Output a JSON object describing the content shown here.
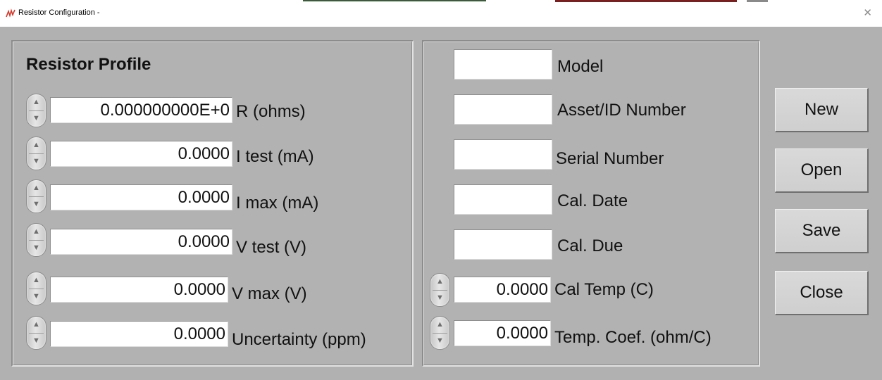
{
  "window": {
    "title": "Resistor Configuration -",
    "close_glyph": "✕",
    "app_icon": "resistor-app-icon"
  },
  "profile": {
    "heading": "Resistor Profile",
    "rows": [
      {
        "value": "0.000000000E+0",
        "label": "R (ohms)"
      },
      {
        "value": "0.0000",
        "label": "I test (mA)"
      },
      {
        "value": "0.0000",
        "label": "I max (mA)"
      },
      {
        "value": "0.0000",
        "label": "V test (V)"
      },
      {
        "value": "0.0000",
        "label": "V max (V)"
      },
      {
        "value": "0.0000",
        "label": "Uncertainty (ppm)"
      }
    ]
  },
  "info": {
    "text_fields": [
      {
        "value": "",
        "label": "Model"
      },
      {
        "value": "",
        "label": "Asset/ID Number"
      },
      {
        "value": "",
        "label": "Serial Number"
      },
      {
        "value": "",
        "label": "Cal. Date"
      },
      {
        "value": "",
        "label": "Cal. Due"
      }
    ],
    "numeric_fields": [
      {
        "value": "0.0000",
        "label": "Cal Temp (C)"
      },
      {
        "value": "0.0000",
        "label": "Temp. Coef. (ohm/C)"
      }
    ]
  },
  "buttons": {
    "new": "New",
    "open": "Open",
    "save": "Save",
    "close": "Close"
  },
  "icons": {
    "spinner_up": "▲",
    "spinner_down": "▼"
  }
}
